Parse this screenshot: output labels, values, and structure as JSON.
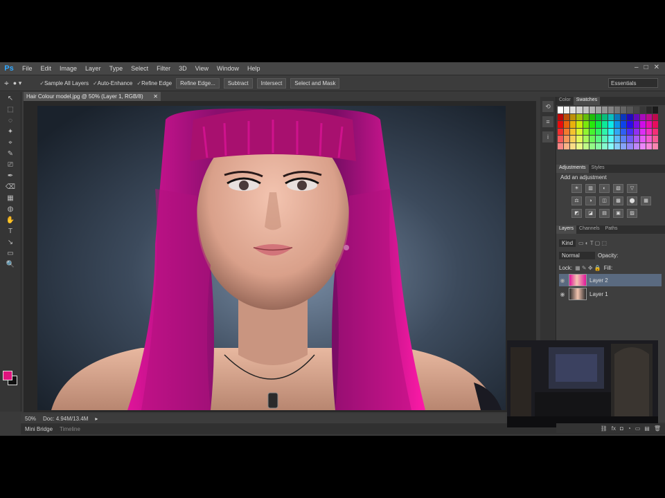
{
  "app": {
    "logo": "Ps"
  },
  "menu": [
    "File",
    "Edit",
    "Image",
    "Layer",
    "Type",
    "Select",
    "Filter",
    "3D",
    "View",
    "Window",
    "Help"
  ],
  "window_controls": [
    "–",
    "□",
    "✕"
  ],
  "options_bar": {
    "tool_icon": "quick-selection-icon",
    "checkbox_1": "Sample All Layers",
    "checkbox_2": "Auto-Enhance",
    "button_1": "Refine Edge...",
    "button_2": "Select and Mask",
    "button_3": "Refine Edge",
    "button_4": "Subtract",
    "button_5": "Intersect",
    "workspace": "Essentials"
  },
  "document_tab": {
    "title": "Hair Colour model.jpg @ 50% (Layer 1, RGB/8)",
    "close": "✕"
  },
  "tools": [
    "↖",
    "⬚",
    "◌",
    "✦",
    "⌖",
    "✎",
    "⎚",
    "✒",
    "⌫",
    "▦",
    "◍",
    "✋",
    "T",
    "↘",
    "▭",
    "🔍"
  ],
  "colors": {
    "foreground": "#e0147e",
    "background": "#111111",
    "panel_bg": "#3e3e3e",
    "selected_layer": "#5a6a80"
  },
  "swatches_panel": {
    "tabs": [
      "Color",
      "Swatches"
    ],
    "active_tab": "Swatches"
  },
  "adjustments_panel": {
    "tabs": [
      "Adjustments",
      "Styles"
    ],
    "title": "Add an adjustment",
    "row1": [
      "☀",
      "▥",
      "◐",
      "▧",
      "▽"
    ],
    "row2": [
      "⚖",
      "◑",
      "◫",
      "▩",
      "⬤",
      "▦"
    ],
    "row3": [
      "◩",
      "◪",
      "▤",
      "▣",
      "▨"
    ]
  },
  "layers_panel": {
    "tabs": [
      "Layers",
      "Channels",
      "Paths"
    ],
    "kind_filter": "Kind",
    "blend_mode": "Normal",
    "opacity_label": "Opacity:",
    "lock_label": "Lock:",
    "fill_label": "Fill:",
    "layers": [
      {
        "name": "Layer 2",
        "selected": true
      },
      {
        "name": "Layer 1",
        "selected": false
      }
    ]
  },
  "status_bar": {
    "zoom": "50%",
    "doc_info": "Doc: 4.94M/13.4M"
  },
  "bottom_bar": {
    "tab_1": "Mini Bridge",
    "tab_2": "Timeline"
  },
  "layers_footer": [
    "⛓",
    "fx",
    "◘",
    "◔",
    "▭",
    "▤",
    "🗑"
  ]
}
